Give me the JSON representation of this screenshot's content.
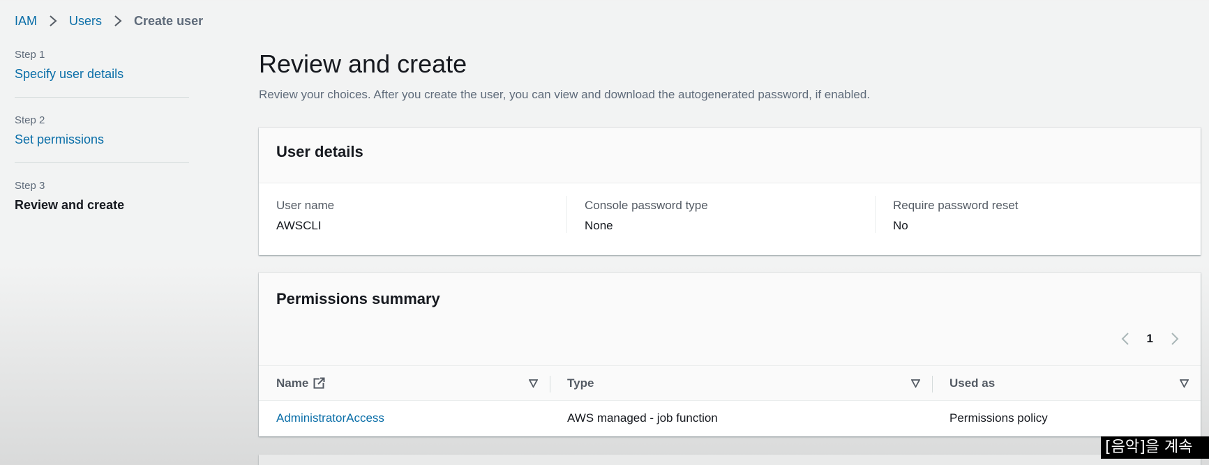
{
  "breadcrumb": {
    "items": [
      {
        "label": "IAM"
      },
      {
        "label": "Users"
      },
      {
        "label": "Create user"
      }
    ]
  },
  "steps": [
    {
      "caption": "Step 1",
      "label": "Specify user details"
    },
    {
      "caption": "Step 2",
      "label": "Set permissions"
    },
    {
      "caption": "Step 3",
      "label": "Review and create"
    }
  ],
  "page": {
    "title": "Review and create",
    "description": "Review your choices. After you create the user, you can view and download the autogenerated password, if enabled."
  },
  "user_details": {
    "title": "User details",
    "fields": [
      {
        "label": "User name",
        "value": "AWSCLI"
      },
      {
        "label": "Console password type",
        "value": "None"
      },
      {
        "label": "Require password reset",
        "value": "No"
      }
    ]
  },
  "permissions_summary": {
    "title": "Permissions summary",
    "pagination": {
      "current_page": "1"
    },
    "columns": [
      "Name",
      "Type",
      "Used as"
    ],
    "rows": [
      {
        "name": "AdministratorAccess",
        "type": "AWS managed - job function",
        "used_as": "Permissions policy"
      }
    ]
  },
  "caption": {
    "text": "[음악]을 계속 "
  },
  "icons": {
    "breadcrumb_separator": "chevron-right-icon",
    "external_link": "external-link-icon",
    "sort": "sort-caret-down-icon",
    "pager_prev": "chevron-left-icon",
    "pager_next": "chevron-right-icon"
  },
  "colors": {
    "link": "#0a6ea8",
    "text": "#16191f",
    "secondary_text": "#5f6b7a",
    "background": "#f2f3f3",
    "card": "#ffffff"
  }
}
